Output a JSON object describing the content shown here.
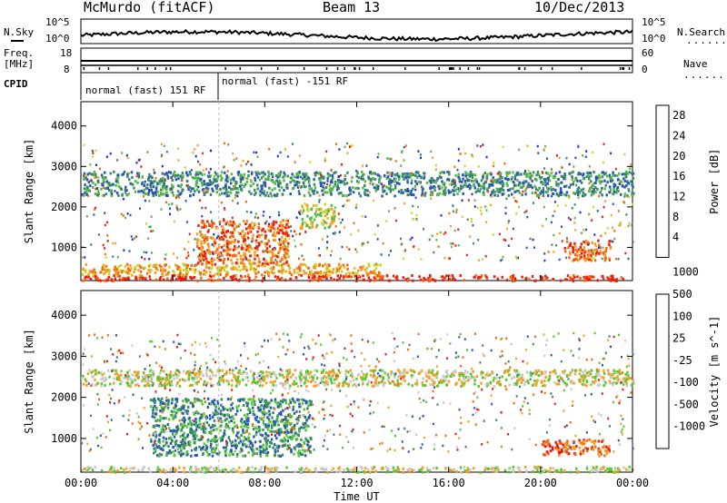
{
  "header": {
    "station": "McMurdo (fitACF)",
    "beam": "Beam 13",
    "date": "10/Dec/2013"
  },
  "top_panels": {
    "nsky_label": "N.Sky",
    "nsky_ticks": [
      "10^5",
      "10^0"
    ],
    "nsearch_label": "N.Search",
    "nsearch_ticks": [
      "10^5",
      "10^0"
    ],
    "freq_label_line1": "Freq.",
    "freq_label_line2": "[MHz]",
    "freq_ticks": [
      "18",
      "8"
    ],
    "nave_label": "Nave",
    "nave_ticks": [
      "60",
      "0"
    ],
    "cpid_label": "CPID",
    "cpid_segments": [
      {
        "text": "normal (fast) 151 RF",
        "start_hour": 0,
        "end_hour": 6
      },
      {
        "text": "normal (fast) -151 RF",
        "start_hour": 6,
        "end_hour": 24
      }
    ],
    "dotted_marker": "......."
  },
  "chart_data": [
    {
      "type": "heatmap",
      "title": "",
      "parameter": "Power",
      "units": "dB",
      "colorbar_label": "Power [dB]",
      "colorbar_ticks": [
        4,
        8,
        12,
        16,
        20,
        24,
        28
      ],
      "colorbar_range": [
        0,
        30
      ],
      "xlabel": "",
      "ylabel": "Slant Range [km]",
      "yticks": [
        1000,
        2000,
        3000,
        4000
      ],
      "ylim": [
        180,
        4600
      ],
      "xlim_hours": [
        0,
        24
      ],
      "colors": [
        "#1a2bd6",
        "#2b55b8",
        "#3a8a6a",
        "#58b84a",
        "#c8d428",
        "#f4a020",
        "#f06a10",
        "#e82010"
      ],
      "echo_bands": [
        {
          "range_km": [
            200,
            340
          ],
          "hours": [
            0,
            24
          ],
          "power_db": 28
        },
        {
          "range_km": [
            340,
            620
          ],
          "hours": [
            0,
            13
          ],
          "power_db": 20
        },
        {
          "range_km": [
            600,
            1700
          ],
          "hours": [
            5,
            9
          ],
          "power_db": 24
        },
        {
          "range_km": [
            2300,
            2900
          ],
          "hours": [
            0,
            24
          ],
          "power_db": 10
        },
        {
          "range_km": [
            1500,
            2100
          ],
          "hours": [
            9.5,
            11
          ],
          "power_db": 18
        },
        {
          "range_km": [
            700,
            1200
          ],
          "hours": [
            21,
            23
          ],
          "power_db": 24
        }
      ]
    },
    {
      "type": "heatmap",
      "title": "",
      "parameter": "Velocity",
      "units": "m s^-1",
      "colorbar_label": "Velocity [m s^-1]",
      "colorbar_ticks": [
        -1000,
        -500,
        -100,
        -25,
        25,
        100,
        500,
        1000
      ],
      "xlabel": "Time UT",
      "xticks": [
        "00:00",
        "04:00",
        "08:00",
        "12:00",
        "16:00",
        "20:00",
        "00:00"
      ],
      "ylabel": "Slant Range [km]",
      "yticks": [
        1000,
        2000,
        3000,
        4000
      ],
      "ylim": [
        180,
        4600
      ],
      "xlim_hours": [
        0,
        24
      ],
      "colors": [
        "#e81818",
        "#f06a10",
        "#f4a020",
        "#c8c8c8",
        "#58c830",
        "#3a8a6a",
        "#2b55b8"
      ],
      "echo_bands": [
        {
          "range_km": [
            200,
            340
          ],
          "hours": [
            0,
            24
          ],
          "velocity_ms": 0
        },
        {
          "range_km": [
            600,
            2000
          ],
          "hours": [
            3,
            10
          ],
          "velocity_ms": 300
        },
        {
          "range_km": [
            2300,
            2700
          ],
          "hours": [
            0,
            24
          ],
          "velocity_ms": 0
        },
        {
          "range_km": [
            600,
            1000
          ],
          "hours": [
            20,
            23
          ],
          "velocity_ms": -200
        }
      ]
    }
  ]
}
